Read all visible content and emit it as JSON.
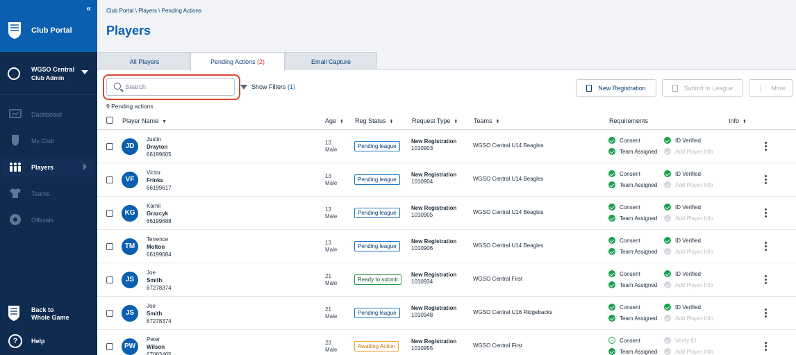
{
  "sidebar": {
    "title": "Club Portal",
    "collapse_glyph": "«",
    "club_name": "WGSO Central",
    "club_role": "Club Admin",
    "nav": [
      {
        "label": "Dashboard",
        "icon": "dashboard-icon",
        "active": false
      },
      {
        "label": "My Club",
        "icon": "shield-icon",
        "active": false
      },
      {
        "label": "Players",
        "icon": "players-icon",
        "active": true
      },
      {
        "label": "Teams",
        "icon": "shirt-icon",
        "active": false
      },
      {
        "label": "Officials",
        "icon": "whistle-icon",
        "active": false
      }
    ],
    "back_line1": "Back to",
    "back_line2": "Whole Game",
    "help": "Help",
    "help_glyph": "?"
  },
  "header": {
    "breadcrumb": "Club Portal \\ Players \\ Pending Actions",
    "title": "Players"
  },
  "tabs": [
    {
      "label": "All Players",
      "count": ""
    },
    {
      "label": "Pending Actions",
      "count": "(2)"
    },
    {
      "label": "Email Capture",
      "count": ""
    }
  ],
  "toolbar": {
    "search_placeholder": "Search",
    "show_filters": "Show Filters",
    "filter_count": "(1)",
    "new_registration": "New Registration",
    "submit_to_league": "Submit to League",
    "more": "More",
    "more_glyph": "⋮"
  },
  "pending_count": "9 Pending actions",
  "columns": {
    "player_name": "Player Name",
    "age": "Age",
    "reg_status": "Reg Status",
    "request_type": "Request Type",
    "teams": "Teams",
    "requirements": "Requirements",
    "info": "Info",
    "sort_desc": "▼",
    "sort_both": "⬍"
  },
  "rows": [
    {
      "initials": "JD",
      "first": "Justin",
      "last": "Drayton",
      "id": "66199605",
      "age": "13",
      "gender": "Male",
      "status": "Pending league",
      "status_kind": "pending",
      "req_type": "New Registration",
      "req_no": "1010903",
      "team": "WGSO Central U14 Beagles",
      "r1": "Consent",
      "r2": "ID Verified",
      "r3": "Team Assigned",
      "r4": "Add Player Info"
    },
    {
      "initials": "VF",
      "first": "Victor",
      "last": "Frinks",
      "id": "66199617",
      "age": "13",
      "gender": "Male",
      "status": "Pending league",
      "status_kind": "pending",
      "req_type": "New Registration",
      "req_no": "1010904",
      "team": "WGSO Central U14 Beagles",
      "r1": "Consent",
      "r2": "ID Verified",
      "r3": "Team Assigned",
      "r4": "Add Player Info"
    },
    {
      "initials": "KG",
      "first": "Kamil",
      "last": "Grazcyk",
      "id": "66199688",
      "age": "13",
      "gender": "Male",
      "status": "Pending league",
      "status_kind": "pending",
      "req_type": "New Registration",
      "req_no": "1010905",
      "team": "WGSO Central U14 Beagles",
      "r1": "Consent",
      "r2": "ID Verified",
      "r3": "Team Assigned",
      "r4": "Add Player Info"
    },
    {
      "initials": "TM",
      "first": "Terrence",
      "last": "Molton",
      "id": "66199684",
      "age": "13",
      "gender": "Male",
      "status": "Pending league",
      "status_kind": "pending",
      "req_type": "New Registration",
      "req_no": "1010906",
      "team": "WGSO Central U14 Beagles",
      "r1": "Consent",
      "r2": "ID Verified",
      "r3": "Team Assigned",
      "r4": "Add Player Info"
    },
    {
      "initials": "JS",
      "first": "Joe",
      "last": "Smith",
      "id": "67278374",
      "age": "21",
      "gender": "Male",
      "status": "Ready to submit",
      "status_kind": "ready",
      "req_type": "New Registration",
      "req_no": "1010934",
      "team": "WGSO Central First",
      "r1": "Consent",
      "r2": "ID Verified",
      "r3": "Team Assigned",
      "r4": "Add Player Info"
    },
    {
      "initials": "JS",
      "first": "Joe",
      "last": "Smith",
      "id": "67278374",
      "age": "21",
      "gender": "Male",
      "status": "Pending league",
      "status_kind": "pending",
      "req_type": "New Registration",
      "req_no": "1010948",
      "team": "WGSO Central U16 Ridgebacks",
      "r1": "Consent",
      "r2": "ID Verified",
      "r3": "Team Assigned",
      "r4": "Add Player Info"
    },
    {
      "initials": "PW",
      "first": "Peter",
      "last": "Wilson",
      "id": "67083405",
      "age": "23",
      "gender": "Male",
      "status": "Awaiting Action",
      "status_kind": "await",
      "req_type": "New Registration",
      "req_no": "1010955",
      "team": "WGSO Central First",
      "r1": "Consent",
      "r2": "Verify ID",
      "r3": "Team Assigned",
      "r4": "Add Player Info"
    }
  ],
  "colors": {
    "sidebar_bg": "#0f2b50",
    "brand_blue": "#0a5fb0",
    "success_green": "#18a04a",
    "alert_red": "#d02c2c",
    "warning_orange": "#f2a53b",
    "highlight_ring": "#d9482f"
  }
}
